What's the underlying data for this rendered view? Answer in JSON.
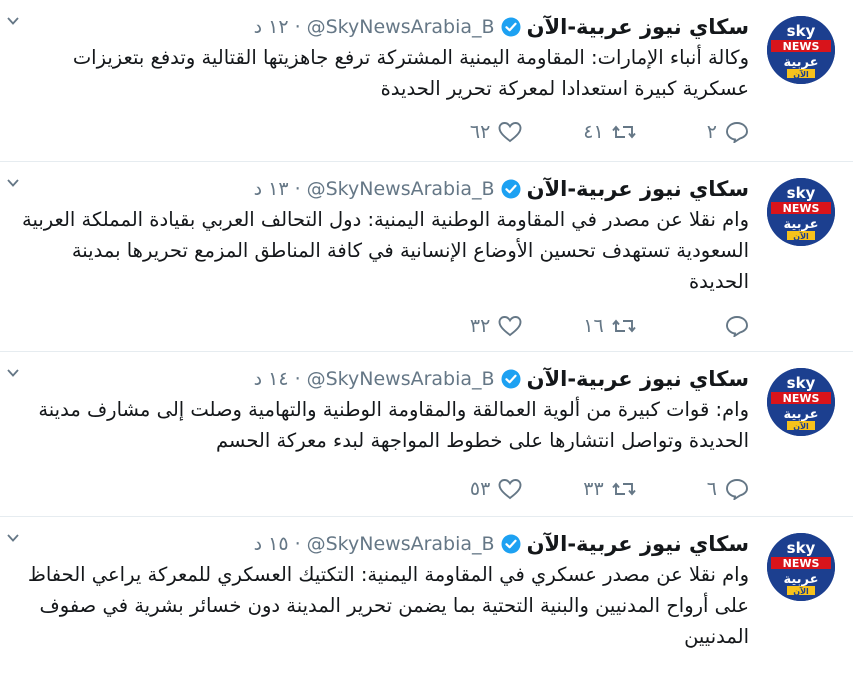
{
  "feed": {
    "tweets": [
      {
        "name": "سكاي نيوز عربية-الآن",
        "handle": "@SkyNewsArabia_B",
        "separator": "·",
        "time": "١٢ د",
        "text": "وكالة أنباء الإمارات: المقاومة اليمنية المشتركة ترفع جاهزيتها القتالية وتدفع بتعزيزات عسكرية كبيرة استعدادا لمعركة تحرير الحديدة",
        "replies": "٢",
        "retweets": "٤١",
        "likes": "٦٢"
      },
      {
        "name": "سكاي نيوز عربية-الآن",
        "handle": "@SkyNewsArabia_B",
        "separator": "·",
        "time": "١٣ د",
        "text": "وام نقلا عن مصدر في المقاومة الوطنية اليمنية: دول التحالف العربي بقيادة المملكة العربية السعودية تستهدف تحسين الأوضاع الإنسانية في كافة المناطق المزمع تحريرها بمدينة الحديدة",
        "replies": "",
        "retweets": "١٦",
        "likes": "٣٢"
      },
      {
        "name": "سكاي نيوز عربية-الآن",
        "handle": "@SkyNewsArabia_B",
        "separator": "·",
        "time": "١٤ د",
        "text": "وام: قوات كبيرة من ألوية العمالقة والمقاومة الوطنية والتهامية وصلت إلى مشارف مدينة الحديدة وتواصل انتشارها على خطوط المواجهة لبدء معركة الحسم",
        "replies": "٦",
        "retweets": "٣٣",
        "likes": "٥٣"
      },
      {
        "name": "سكاي نيوز عربية-الآن",
        "handle": "@SkyNewsArabia_B",
        "separator": "·",
        "time": "١٥ د",
        "text": "وام نقلا عن مصدر عسكري في المقاومة اليمنية: التكتيك العسكري للمعركة يراعي الحفاظ على أرواح المدنيين والبنية التحتية بما يضمن تحرير المدينة دون خسائر بشرية في صفوف المدنيين"
      }
    ]
  },
  "avatar": {
    "brand": "sky",
    "brand2": "NEWS",
    "brand3": "عربية",
    "brand4": "الآن"
  },
  "colors": {
    "accent": "#1da1f2",
    "muted": "#657786",
    "avatar_blue": "#1c3f8f",
    "news_red": "#d8141b",
    "now_yellow": "#f7c21b"
  },
  "icons": {
    "reply": "reply-icon",
    "retweet": "retweet-icon",
    "like": "heart-icon",
    "caret": "chevron-down-icon",
    "verified": "verified-badge-icon"
  }
}
